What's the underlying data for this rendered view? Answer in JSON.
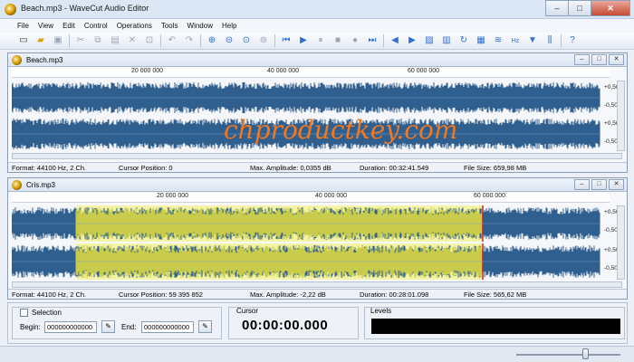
{
  "app": {
    "title": "Beach.mp3 - WaveCut Audio Editor"
  },
  "window_controls": {
    "minimize": "–",
    "maximize": "□",
    "close": "✕"
  },
  "menu": [
    "File",
    "View",
    "Edit",
    "Control",
    "Operations",
    "Tools",
    "Window",
    "Help"
  ],
  "toolbar": [
    {
      "icon": "new-file-icon",
      "glyph": "▭",
      "color": "c-dark"
    },
    {
      "icon": "open-folder-icon",
      "glyph": "▰",
      "color": "c-yellow"
    },
    {
      "icon": "save-icon",
      "glyph": "▣",
      "color": "c-gray"
    },
    {
      "sep": true
    },
    {
      "icon": "cut-icon",
      "glyph": "✂",
      "color": "c-gray"
    },
    {
      "icon": "copy-icon",
      "glyph": "⧉",
      "color": "c-gray"
    },
    {
      "icon": "paste-icon",
      "glyph": "▤",
      "color": "c-gray"
    },
    {
      "icon": "delete-icon",
      "glyph": "✕",
      "color": "c-gray"
    },
    {
      "icon": "crop-icon",
      "glyph": "⊡",
      "color": "c-gray"
    },
    {
      "sep": true
    },
    {
      "icon": "undo-icon",
      "glyph": "↶",
      "color": "c-gray"
    },
    {
      "icon": "redo-icon",
      "glyph": "↷",
      "color": "c-gray"
    },
    {
      "sep": true
    },
    {
      "icon": "zoom-in-icon",
      "glyph": "⊕",
      "color": "c-blue"
    },
    {
      "icon": "zoom-out-icon",
      "glyph": "⊖",
      "color": "c-blue"
    },
    {
      "icon": "zoom-selection-icon",
      "glyph": "⊙",
      "color": "c-blue"
    },
    {
      "icon": "zoom-all-icon",
      "glyph": "⊚",
      "color": "c-gray"
    },
    {
      "sep": true
    },
    {
      "icon": "go-start-icon",
      "glyph": "⏮",
      "color": "c-blue"
    },
    {
      "icon": "play-icon",
      "glyph": "▶",
      "color": "c-blue"
    },
    {
      "icon": "pause-icon",
      "glyph": "⏸",
      "color": "c-gray"
    },
    {
      "icon": "stop-icon",
      "glyph": "■",
      "color": "c-gray"
    },
    {
      "icon": "record-icon",
      "glyph": "●",
      "color": "c-gray"
    },
    {
      "icon": "go-end-icon",
      "glyph": "⏭",
      "color": "c-blue"
    },
    {
      "sep": true
    },
    {
      "icon": "rewind-icon",
      "glyph": "◀",
      "color": "c-blue"
    },
    {
      "icon": "forward-icon",
      "glyph": "▶",
      "color": "c-blue"
    },
    {
      "icon": "waveform-icon",
      "glyph": "▨",
      "color": "c-blue"
    },
    {
      "icon": "spectrum-icon",
      "glyph": "▥",
      "color": "c-blue"
    },
    {
      "icon": "loop-icon",
      "glyph": "↻",
      "color": "c-blue"
    },
    {
      "icon": "equalizer-icon",
      "glyph": "▦",
      "color": "c-blue"
    },
    {
      "icon": "amplitude-icon",
      "glyph": "≋",
      "color": "c-blue"
    },
    {
      "icon": "frequency-icon",
      "glyph": "Hz",
      "color": "c-blue"
    },
    {
      "icon": "filter-icon",
      "glyph": "▼",
      "color": "c-blue"
    },
    {
      "icon": "mixer-icon",
      "glyph": "⫼",
      "color": "c-blue"
    },
    {
      "sep": true
    },
    {
      "icon": "help-icon",
      "glyph": "?",
      "color": "c-blue"
    }
  ],
  "doc1": {
    "name": "Beach.mp3",
    "ruler": [
      "20 000 000",
      "40 000 000",
      "60 000 000"
    ],
    "scale": [
      "+0,50",
      "-0,50",
      "+0,50",
      "-0,50"
    ],
    "status": {
      "format": "Format: 44100 Hz, 2 Ch.",
      "cursor": "Cursor Position: 0",
      "amplitude": "Max. Amplitude: 0,0355 dB",
      "duration": "Duration: 00:32:41.549",
      "filesize": "File Size: 659,98 MB"
    }
  },
  "doc2": {
    "name": "Cris.mp3",
    "ruler": [
      "20 000 000",
      "40 000 000",
      "60 000 000"
    ],
    "scale": [
      "+0,50",
      "-0,50",
      "+0,50",
      "-0,50"
    ],
    "selection_start_fraction": 0.11,
    "selection_end_fraction": 0.8,
    "status": {
      "format": "Format: 44100 Hz, 2 Ch.",
      "cursor": "Cursor Position: 59 395 852",
      "amplitude": "Max. Amplitude: -2,22 dB",
      "duration": "Duration: 00:28:01.098",
      "filesize": "File Size: 565,62 MB"
    }
  },
  "doc_controls": {
    "minimize": "–",
    "maximize": "□",
    "close": "✕"
  },
  "selection_panel": {
    "label": "Selection",
    "checked": false,
    "begin_label": "Begin:",
    "begin_value": "000000000000",
    "end_label": "End:",
    "end_value": "000000000000"
  },
  "cursor_panel": {
    "label": "Cursor",
    "time": "00:00:00.000"
  },
  "levels_panel": {
    "label": "Levels"
  },
  "zoom_slider_level": 0.66,
  "watermark": "chproductkey.com"
}
